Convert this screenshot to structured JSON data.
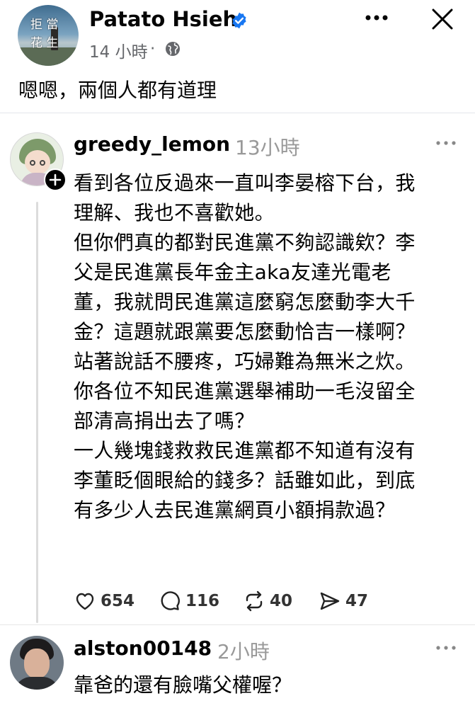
{
  "post": {
    "author": "Patato Hsieh",
    "avatar_text": [
      "拒 當",
      "花 生"
    ],
    "time": "14 小時",
    "separator": "·",
    "caption": "嗯嗯，兩個人都有道理"
  },
  "comments": [
    {
      "username": "greedy_lemon",
      "time": "13小時",
      "lines": [
        "看到各位反過來一直叫李晏榕下台，我",
        "理解、我也不喜歡她。",
        "但你們真的都對民進黨不夠認識欸？李",
        "父是民進黨長年金主aka友達光電老",
        "董，我就問民進黨這麼窮怎麼動李大千",
        "金？這題就跟黨要怎麼動恰吉一樣啊？",
        "站著說話不腰疼，巧婦難為無米之炊。",
        "你各位不知民進黨選舉補助一毛沒留全",
        "部清高捐出去了嗎？",
        "一人幾塊錢救救民進黨都不知道有沒有",
        "李董眨個眼給的錢多？話雖如此，到底",
        "有多少人去民進黨網頁小額捐款過？"
      ],
      "likes": "654",
      "replies": "116",
      "reposts": "40",
      "shares": "47"
    },
    {
      "username": "alston00148",
      "time": "2小時",
      "text": "靠爸的還有臉嘴父權喔？"
    }
  ],
  "colors": {
    "verified": "#1877F2",
    "secondary_text": "#65676B",
    "threads_time": "#999999"
  },
  "icons": {
    "verified": "verified-badge-icon",
    "globe": "globe-icon",
    "more": "more-horizontal-icon",
    "close": "close-icon",
    "follow": "follow-plus-icon",
    "like": "heart-icon",
    "reply": "comment-icon",
    "repost": "repost-icon",
    "share": "send-icon"
  }
}
